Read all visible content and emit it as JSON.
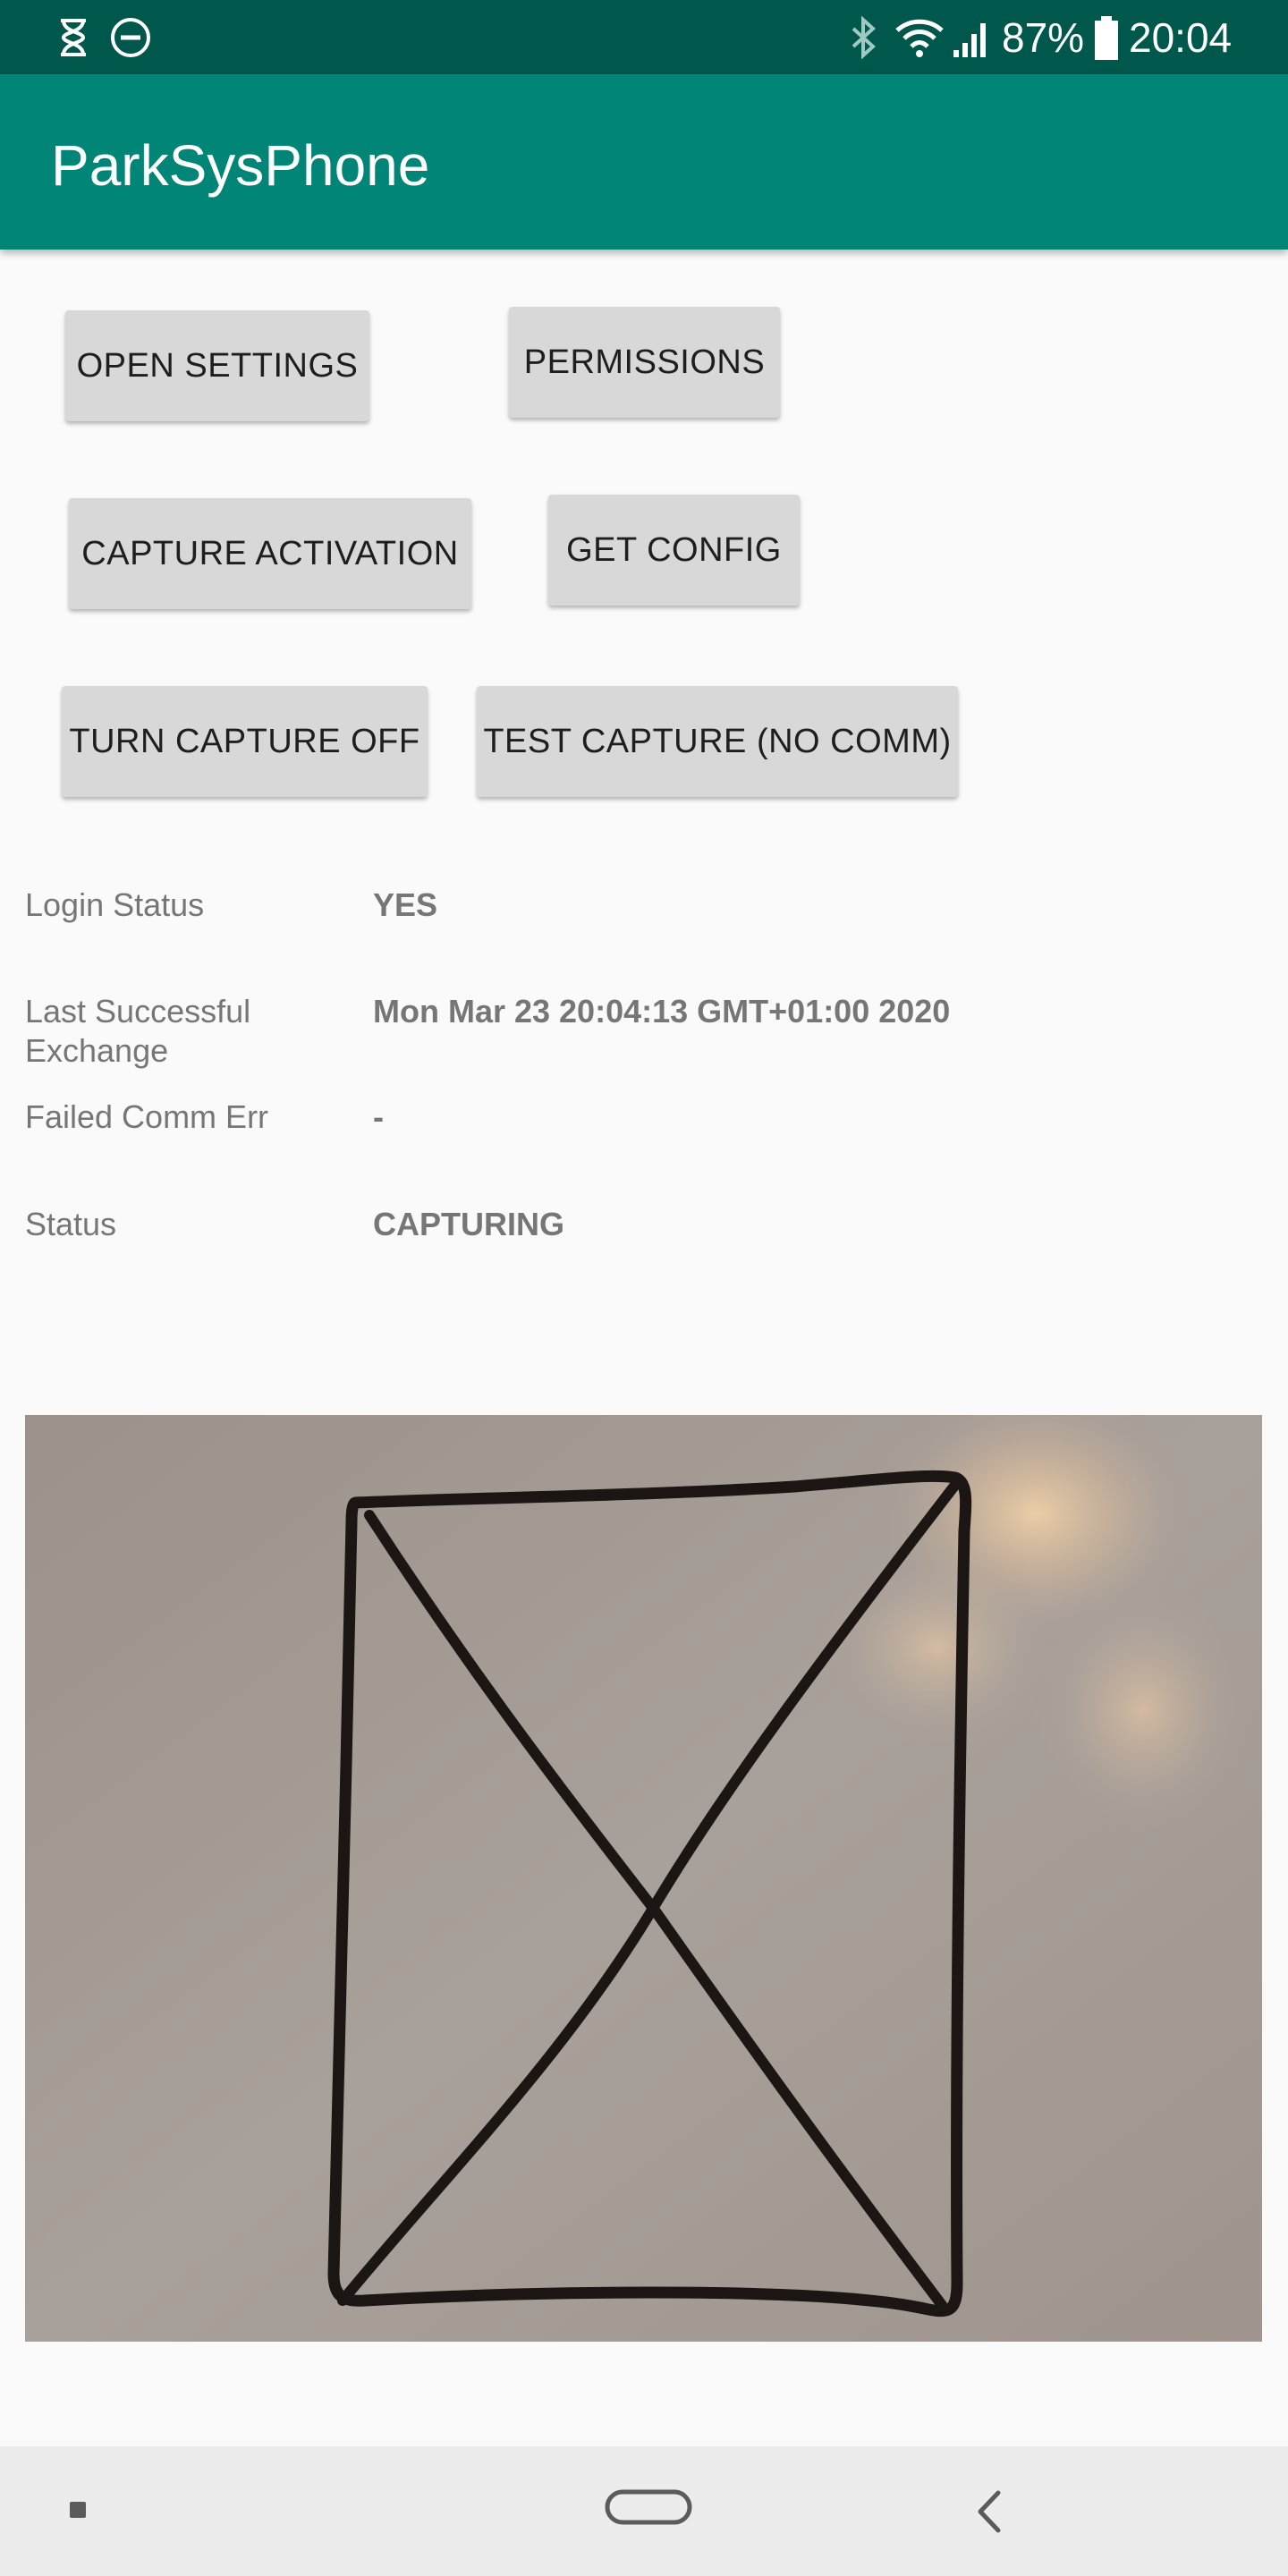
{
  "status_bar": {
    "battery_percent": "87%",
    "time": "20:04",
    "icons": [
      "hourglass-icon",
      "do-not-disturb-icon",
      "bluetooth-icon",
      "wifi-icon",
      "signal-icon",
      "battery-icon"
    ]
  },
  "app_bar": {
    "title": "ParkSysPhone",
    "color": "#008577",
    "status_color": "#00574b"
  },
  "buttons": {
    "open_settings": "OPEN SETTINGS",
    "permissions": "PERMISSIONS",
    "capture_activation": "CAPTURE ACTIVATION",
    "get_config": "GET CONFIG",
    "turn_capture_off": "TURN CAPTURE OFF",
    "test_capture": "TEST CAPTURE (NO COMM)"
  },
  "info": {
    "login_status_label": "Login Status",
    "login_status_value": "YES",
    "last_exchange_label_line1": "Last Successful",
    "last_exchange_label_line2": "Exchange",
    "last_exchange_value": "Mon Mar 23 20:04:13 GMT+01:00 2020",
    "failed_comm_label": "Failed Comm Err",
    "failed_comm_value": "-",
    "status_label": "Status",
    "status_value": "CAPTURING"
  },
  "camera_preview": {
    "content": "camera-preview-image"
  },
  "nav_bar": {
    "icons": [
      "recent-apps-icon",
      "home-icon",
      "back-icon"
    ]
  }
}
